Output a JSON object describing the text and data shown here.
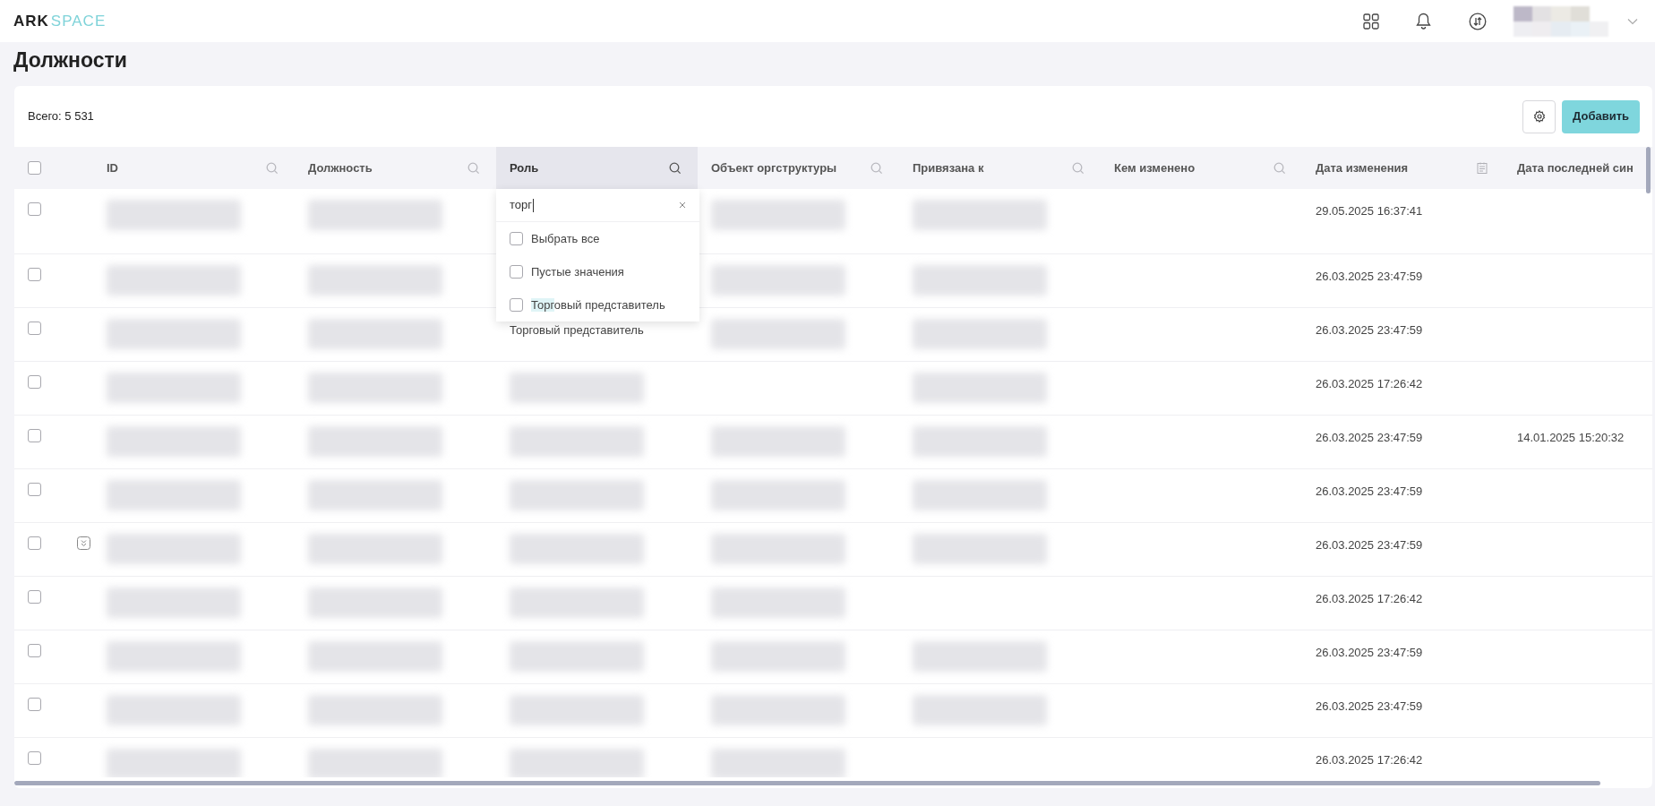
{
  "header": {
    "logo": {
      "part1": "ARK",
      "part2": "SPACE"
    }
  },
  "page": {
    "title": "Должности"
  },
  "toolbar": {
    "total": "Всего: 5 531",
    "add_button": "Добавить"
  },
  "table": {
    "select_all_checked": false,
    "columns": [
      {
        "label": "ID",
        "kind": "search",
        "active": false
      },
      {
        "label": "Должность",
        "kind": "search",
        "active": false
      },
      {
        "label": "Роль",
        "kind": "search",
        "active": true
      },
      {
        "label": "Объект оргструктуры",
        "kind": "search",
        "active": false
      },
      {
        "label": "Привязана к",
        "kind": "search",
        "active": false
      },
      {
        "label": "Кем изменено",
        "kind": "search",
        "active": false
      },
      {
        "label": "Дата изменения",
        "kind": "date",
        "active": false
      },
      {
        "label": "Дата последней син",
        "kind": "plain",
        "active": false
      }
    ],
    "rows": [
      {
        "checked": false,
        "expandable": false,
        "tall": true,
        "cells": [
          {
            "kind": "blurred"
          },
          {
            "kind": "blurred"
          },
          {
            "kind": "empty"
          },
          {
            "kind": "blurred"
          },
          {
            "kind": "blurred"
          },
          {
            "kind": "empty"
          },
          {
            "kind": "text",
            "text": "29.05.2025 16:37:41"
          },
          {
            "kind": "empty"
          }
        ]
      },
      {
        "checked": false,
        "expandable": false,
        "tall": false,
        "cells": [
          {
            "kind": "blurred"
          },
          {
            "kind": "blurred"
          },
          {
            "kind": "empty"
          },
          {
            "kind": "blurred"
          },
          {
            "kind": "blurred"
          },
          {
            "kind": "empty"
          },
          {
            "kind": "text",
            "text": "26.03.2025 23:47:59"
          },
          {
            "kind": "empty"
          }
        ]
      },
      {
        "checked": false,
        "expandable": false,
        "tall": false,
        "cells": [
          {
            "kind": "blurred"
          },
          {
            "kind": "blurred"
          },
          {
            "kind": "text",
            "text": "Торговый представитель"
          },
          {
            "kind": "blurred"
          },
          {
            "kind": "blurred"
          },
          {
            "kind": "empty"
          },
          {
            "kind": "text",
            "text": "26.03.2025 23:47:59"
          },
          {
            "kind": "empty"
          }
        ]
      },
      {
        "checked": false,
        "expandable": false,
        "tall": false,
        "cells": [
          {
            "kind": "blurred"
          },
          {
            "kind": "blurred"
          },
          {
            "kind": "blurred"
          },
          {
            "kind": "empty"
          },
          {
            "kind": "blurred"
          },
          {
            "kind": "empty"
          },
          {
            "kind": "text",
            "text": "26.03.2025 17:26:42"
          },
          {
            "kind": "empty"
          }
        ]
      },
      {
        "checked": false,
        "expandable": false,
        "tall": false,
        "cells": [
          {
            "kind": "blurred"
          },
          {
            "kind": "blurred"
          },
          {
            "kind": "blurred"
          },
          {
            "kind": "blurred"
          },
          {
            "kind": "blurred"
          },
          {
            "kind": "empty"
          },
          {
            "kind": "text",
            "text": "26.03.2025 23:47:59"
          },
          {
            "kind": "text",
            "text": "14.01.2025 15:20:32"
          }
        ]
      },
      {
        "checked": false,
        "expandable": false,
        "tall": false,
        "cells": [
          {
            "kind": "blurred"
          },
          {
            "kind": "blurred"
          },
          {
            "kind": "blurred"
          },
          {
            "kind": "blurred"
          },
          {
            "kind": "blurred"
          },
          {
            "kind": "empty"
          },
          {
            "kind": "text",
            "text": "26.03.2025 23:47:59"
          },
          {
            "kind": "empty"
          }
        ]
      },
      {
        "checked": false,
        "expandable": true,
        "tall": false,
        "cells": [
          {
            "kind": "blurred"
          },
          {
            "kind": "blurred"
          },
          {
            "kind": "blurred"
          },
          {
            "kind": "blurred"
          },
          {
            "kind": "blurred"
          },
          {
            "kind": "empty"
          },
          {
            "kind": "text",
            "text": "26.03.2025 23:47:59"
          },
          {
            "kind": "empty"
          }
        ]
      },
      {
        "checked": false,
        "expandable": false,
        "tall": false,
        "cells": [
          {
            "kind": "blurred"
          },
          {
            "kind": "blurred"
          },
          {
            "kind": "blurred"
          },
          {
            "kind": "blurred"
          },
          {
            "kind": "empty"
          },
          {
            "kind": "empty"
          },
          {
            "kind": "text",
            "text": "26.03.2025 17:26:42"
          },
          {
            "kind": "empty"
          }
        ]
      },
      {
        "checked": false,
        "expandable": false,
        "tall": false,
        "cells": [
          {
            "kind": "blurred"
          },
          {
            "kind": "blurred"
          },
          {
            "kind": "blurred"
          },
          {
            "kind": "blurred"
          },
          {
            "kind": "blurred"
          },
          {
            "kind": "empty"
          },
          {
            "kind": "text",
            "text": "26.03.2025 23:47:59"
          },
          {
            "kind": "empty"
          }
        ]
      },
      {
        "checked": false,
        "expandable": false,
        "tall": false,
        "cells": [
          {
            "kind": "blurred"
          },
          {
            "kind": "blurred"
          },
          {
            "kind": "blurred"
          },
          {
            "kind": "blurred"
          },
          {
            "kind": "blurred"
          },
          {
            "kind": "empty"
          },
          {
            "kind": "text",
            "text": "26.03.2025 23:47:59"
          },
          {
            "kind": "empty"
          }
        ]
      },
      {
        "checked": false,
        "expandable": false,
        "tall": false,
        "cells": [
          {
            "kind": "blurred"
          },
          {
            "kind": "blurred"
          },
          {
            "kind": "blurred"
          },
          {
            "kind": "blurred"
          },
          {
            "kind": "empty"
          },
          {
            "kind": "empty"
          },
          {
            "kind": "text",
            "text": "26.03.2025 17:26:42"
          },
          {
            "kind": "empty"
          }
        ]
      }
    ]
  },
  "filter_dropdown": {
    "value": "торг",
    "options": [
      {
        "checked": false,
        "parts": [
          {
            "text": "Выбрать все",
            "highlighted": false
          }
        ]
      },
      {
        "checked": false,
        "parts": [
          {
            "text": "Пустые значения",
            "highlighted": false
          }
        ]
      },
      {
        "checked": false,
        "parts": [
          {
            "text": "Торг",
            "highlighted": true
          },
          {
            "text": "овый представитель",
            "highlighted": false
          }
        ]
      }
    ]
  }
}
